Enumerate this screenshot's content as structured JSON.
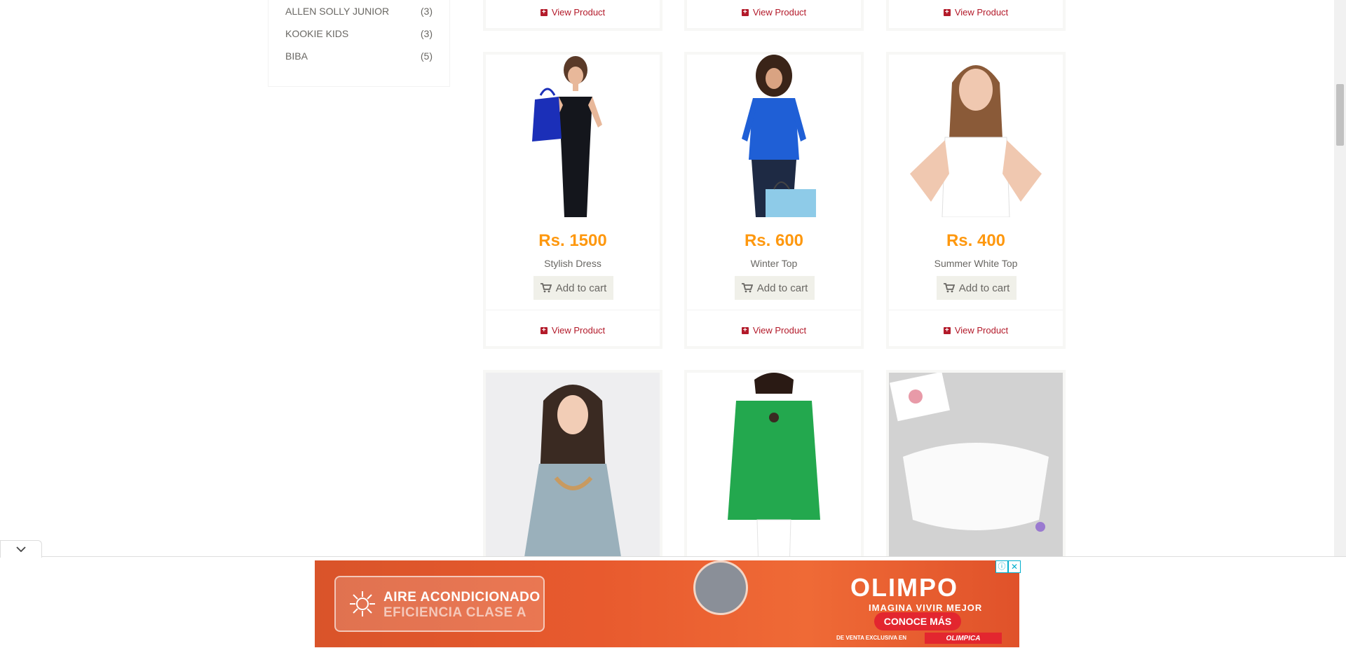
{
  "sidebar": {
    "brands": [
      {
        "name": "ALLEN SOLLY JUNIOR",
        "count": "(3)"
      },
      {
        "name": "KOOKIE KIDS",
        "count": "(3)"
      },
      {
        "name": "BIBA",
        "count": "(5)"
      }
    ]
  },
  "products": {
    "view_label": "View Product",
    "cart_label": "Add to cart",
    "row2": [
      {
        "price": "Rs. 1500",
        "name": "Stylish Dress"
      },
      {
        "price": "Rs. 600",
        "name": "Winter Top"
      },
      {
        "price": "Rs. 400",
        "name": "Summer White Top"
      }
    ]
  },
  "ad": {
    "line1": "AIRE ACONDICIONADO",
    "line2": "EFICIENCIA CLASE A",
    "brand": "OLIMPO",
    "tagline": "IMAGINA VIVIR MEJOR",
    "cta": "CONOCE MÁS",
    "exclusive": "DE VENTA EXCLUSIVA EN",
    "store": "OLIMPICA",
    "info": "ⓘ",
    "close": "✕"
  },
  "colors": {
    "price": "#fe980f",
    "link": "#b31a2a",
    "button_bg": "#f0f0e9",
    "ad_orange": "#e85a2e"
  }
}
